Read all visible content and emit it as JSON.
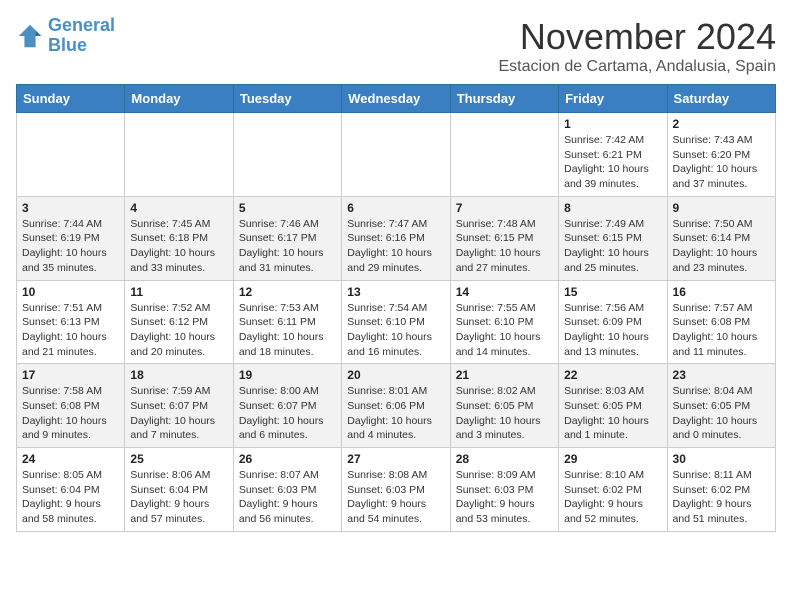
{
  "logo": {
    "line1": "General",
    "line2": "Blue"
  },
  "title": "November 2024",
  "subtitle": "Estacion de Cartama, Andalusia, Spain",
  "headers": [
    "Sunday",
    "Monday",
    "Tuesday",
    "Wednesday",
    "Thursday",
    "Friday",
    "Saturday"
  ],
  "weeks": [
    [
      {
        "day": "",
        "info": ""
      },
      {
        "day": "",
        "info": ""
      },
      {
        "day": "",
        "info": ""
      },
      {
        "day": "",
        "info": ""
      },
      {
        "day": "",
        "info": ""
      },
      {
        "day": "1",
        "info": "Sunrise: 7:42 AM\nSunset: 6:21 PM\nDaylight: 10 hours and 39 minutes."
      },
      {
        "day": "2",
        "info": "Sunrise: 7:43 AM\nSunset: 6:20 PM\nDaylight: 10 hours and 37 minutes."
      }
    ],
    [
      {
        "day": "3",
        "info": "Sunrise: 7:44 AM\nSunset: 6:19 PM\nDaylight: 10 hours and 35 minutes."
      },
      {
        "day": "4",
        "info": "Sunrise: 7:45 AM\nSunset: 6:18 PM\nDaylight: 10 hours and 33 minutes."
      },
      {
        "day": "5",
        "info": "Sunrise: 7:46 AM\nSunset: 6:17 PM\nDaylight: 10 hours and 31 minutes."
      },
      {
        "day": "6",
        "info": "Sunrise: 7:47 AM\nSunset: 6:16 PM\nDaylight: 10 hours and 29 minutes."
      },
      {
        "day": "7",
        "info": "Sunrise: 7:48 AM\nSunset: 6:15 PM\nDaylight: 10 hours and 27 minutes."
      },
      {
        "day": "8",
        "info": "Sunrise: 7:49 AM\nSunset: 6:15 PM\nDaylight: 10 hours and 25 minutes."
      },
      {
        "day": "9",
        "info": "Sunrise: 7:50 AM\nSunset: 6:14 PM\nDaylight: 10 hours and 23 minutes."
      }
    ],
    [
      {
        "day": "10",
        "info": "Sunrise: 7:51 AM\nSunset: 6:13 PM\nDaylight: 10 hours and 21 minutes."
      },
      {
        "day": "11",
        "info": "Sunrise: 7:52 AM\nSunset: 6:12 PM\nDaylight: 10 hours and 20 minutes."
      },
      {
        "day": "12",
        "info": "Sunrise: 7:53 AM\nSunset: 6:11 PM\nDaylight: 10 hours and 18 minutes."
      },
      {
        "day": "13",
        "info": "Sunrise: 7:54 AM\nSunset: 6:10 PM\nDaylight: 10 hours and 16 minutes."
      },
      {
        "day": "14",
        "info": "Sunrise: 7:55 AM\nSunset: 6:10 PM\nDaylight: 10 hours and 14 minutes."
      },
      {
        "day": "15",
        "info": "Sunrise: 7:56 AM\nSunset: 6:09 PM\nDaylight: 10 hours and 13 minutes."
      },
      {
        "day": "16",
        "info": "Sunrise: 7:57 AM\nSunset: 6:08 PM\nDaylight: 10 hours and 11 minutes."
      }
    ],
    [
      {
        "day": "17",
        "info": "Sunrise: 7:58 AM\nSunset: 6:08 PM\nDaylight: 10 hours and 9 minutes."
      },
      {
        "day": "18",
        "info": "Sunrise: 7:59 AM\nSunset: 6:07 PM\nDaylight: 10 hours and 7 minutes."
      },
      {
        "day": "19",
        "info": "Sunrise: 8:00 AM\nSunset: 6:07 PM\nDaylight: 10 hours and 6 minutes."
      },
      {
        "day": "20",
        "info": "Sunrise: 8:01 AM\nSunset: 6:06 PM\nDaylight: 10 hours and 4 minutes."
      },
      {
        "day": "21",
        "info": "Sunrise: 8:02 AM\nSunset: 6:05 PM\nDaylight: 10 hours and 3 minutes."
      },
      {
        "day": "22",
        "info": "Sunrise: 8:03 AM\nSunset: 6:05 PM\nDaylight: 10 hours and 1 minute."
      },
      {
        "day": "23",
        "info": "Sunrise: 8:04 AM\nSunset: 6:05 PM\nDaylight: 10 hours and 0 minutes."
      }
    ],
    [
      {
        "day": "24",
        "info": "Sunrise: 8:05 AM\nSunset: 6:04 PM\nDaylight: 9 hours and 58 minutes."
      },
      {
        "day": "25",
        "info": "Sunrise: 8:06 AM\nSunset: 6:04 PM\nDaylight: 9 hours and 57 minutes."
      },
      {
        "day": "26",
        "info": "Sunrise: 8:07 AM\nSunset: 6:03 PM\nDaylight: 9 hours and 56 minutes."
      },
      {
        "day": "27",
        "info": "Sunrise: 8:08 AM\nSunset: 6:03 PM\nDaylight: 9 hours and 54 minutes."
      },
      {
        "day": "28",
        "info": "Sunrise: 8:09 AM\nSunset: 6:03 PM\nDaylight: 9 hours and 53 minutes."
      },
      {
        "day": "29",
        "info": "Sunrise: 8:10 AM\nSunset: 6:02 PM\nDaylight: 9 hours and 52 minutes."
      },
      {
        "day": "30",
        "info": "Sunrise: 8:11 AM\nSunset: 6:02 PM\nDaylight: 9 hours and 51 minutes."
      }
    ]
  ]
}
